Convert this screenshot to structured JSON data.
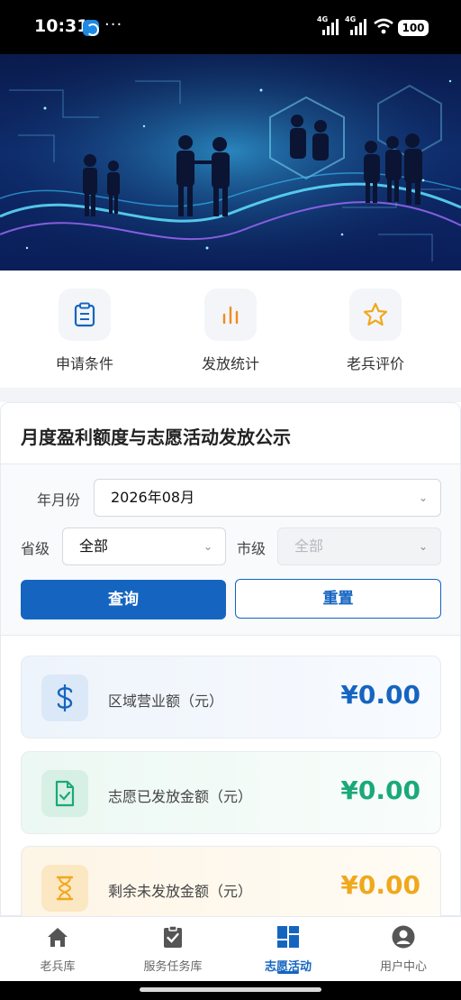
{
  "status_bar": {
    "time": "10:31",
    "dots": "···",
    "network1": "4G",
    "network2": "4G",
    "battery": "100"
  },
  "quick_menu": [
    {
      "label": "申请条件",
      "icon": "clipboard-icon"
    },
    {
      "label": "发放统计",
      "icon": "bar-chart-icon"
    },
    {
      "label": "老兵评价",
      "icon": "star-icon"
    }
  ],
  "card": {
    "title": "月度盈利额度与志愿活动发放公示",
    "filters": {
      "month_label": "年月份",
      "month_value": "2026年08月",
      "province_label": "省级",
      "province_value": "全部",
      "city_label": "市级",
      "city_value": "全部"
    },
    "buttons": {
      "query": "查询",
      "reset": "重置"
    },
    "stats": [
      {
        "label": "区域营业额（元）",
        "value": "¥0.00",
        "color": "#1565c0",
        "icon": "dollar-icon"
      },
      {
        "label": "志愿已发放金额（元）",
        "value": "¥0.00",
        "color": "#1aa97a",
        "icon": "file-check-icon"
      },
      {
        "label": "剩余未发放金额（元）",
        "value": "¥0.00",
        "color": "#f0a81c",
        "icon": "hourglass-icon"
      }
    ]
  },
  "tab_bar": [
    {
      "label": "老兵库",
      "icon": "home-icon"
    },
    {
      "label": "服务任务库",
      "icon": "task-check-icon"
    },
    {
      "label": "志愿活动",
      "icon": "grid-icon",
      "active": true
    },
    {
      "label": "用户中心",
      "icon": "user-icon"
    }
  ]
}
